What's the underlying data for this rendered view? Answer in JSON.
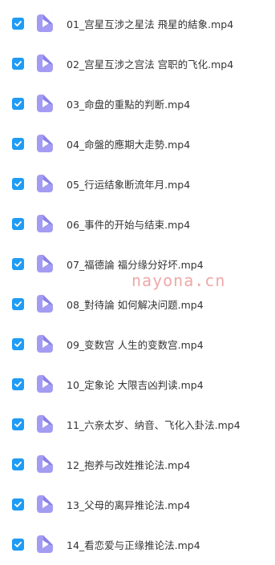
{
  "colors": {
    "checkbox": "#1f9cf5",
    "file_icon": "#a39cf2",
    "text": "#333333",
    "watermark": "#e26060"
  },
  "icons": {
    "checkbox": "checkmark-icon",
    "file": "video-file-icon"
  },
  "files": [
    {
      "name": "01_宫星互涉之星法 飛星的結象.mp4",
      "checked": true
    },
    {
      "name": "02_宫星互涉之宫法 宫职的飞化.mp4",
      "checked": true
    },
    {
      "name": "03_命盘的重點的判断.mp4",
      "checked": true
    },
    {
      "name": "04_命盤的應期大走勢.mp4",
      "checked": true
    },
    {
      "name": "05_行运结象断流年月.mp4",
      "checked": true
    },
    {
      "name": "06_事件的开始与结束.mp4",
      "checked": true
    },
    {
      "name": "07_福德論 福分缘分好坏.mp4",
      "checked": true
    },
    {
      "name": "08_對待論 如何解决问题.mp4",
      "checked": true
    },
    {
      "name": "09_变数宫 人生的变数宫.mp4",
      "checked": true
    },
    {
      "name": "10_定象论 大限吉凶判读.mp4",
      "checked": true
    },
    {
      "name": "11_六亲太岁、纳音、飞化入卦法.mp4",
      "checked": true
    },
    {
      "name": "12_抱养与改姓推论法.mp4",
      "checked": true
    },
    {
      "name": "13_父母的离异推论法.mp4",
      "checked": true
    },
    {
      "name": "14_看恋爱与正缘推论法.mp4",
      "checked": true
    }
  ],
  "watermark": "nayona.cn"
}
